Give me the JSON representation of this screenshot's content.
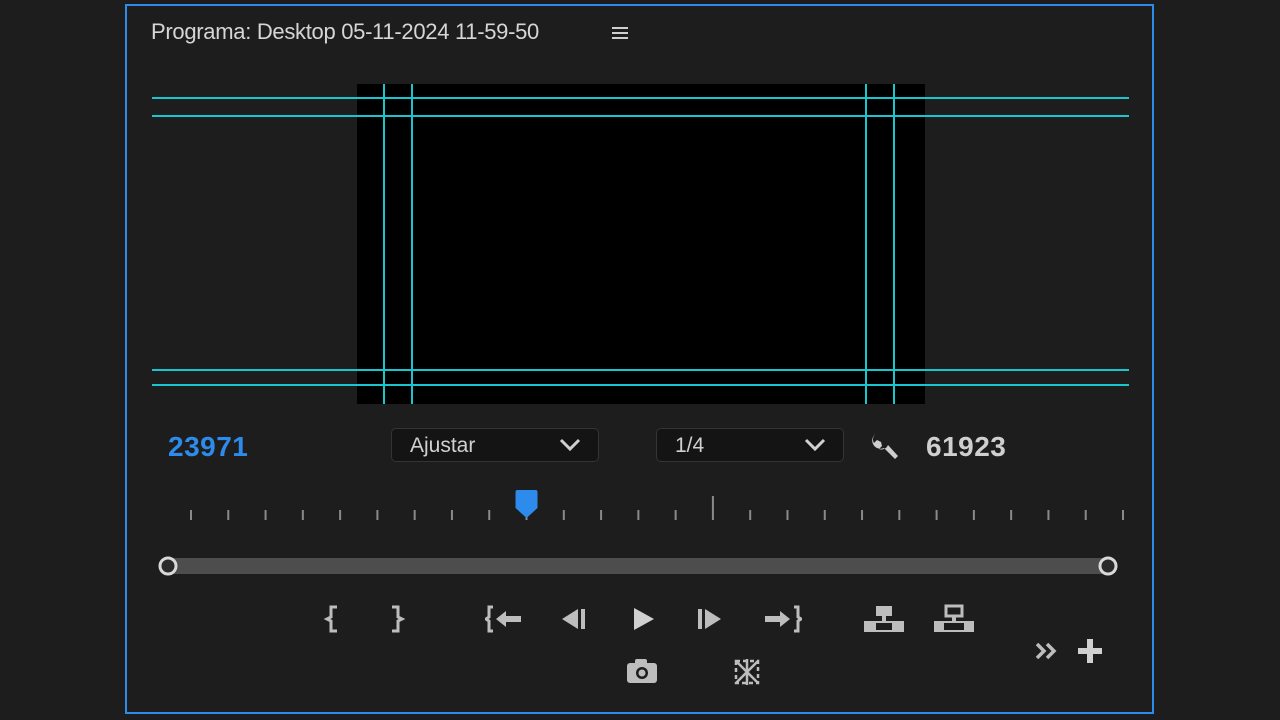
{
  "panel": {
    "title": "Programa: Desktop 05-11-2024 11-59-50",
    "menu_icon": "hamburger-menu-icon",
    "accent_color": "#2d8ceb",
    "guide_color": "#19c6d0"
  },
  "timecode": {
    "current": "23971",
    "duration": "61923"
  },
  "zoom_dropdown": {
    "selected": "Ajustar"
  },
  "resolution_dropdown": {
    "selected": "1/4"
  },
  "settings": {
    "icon": "wrench-icon"
  },
  "playhead": {
    "position_fraction": 0.36
  },
  "controls": {
    "row1": [
      {
        "name": "mark-in-button",
        "icon": "mark-in-icon"
      },
      {
        "name": "mark-out-button",
        "icon": "mark-out-icon"
      },
      {
        "name": "go-to-in-button",
        "icon": "go-to-in-icon"
      },
      {
        "name": "step-back-button",
        "icon": "step-back-icon"
      },
      {
        "name": "play-button",
        "icon": "play-icon"
      },
      {
        "name": "step-forward-button",
        "icon": "step-forward-icon"
      },
      {
        "name": "go-to-out-button",
        "icon": "go-to-out-icon"
      },
      {
        "name": "lift-button",
        "icon": "lift-icon"
      },
      {
        "name": "extract-button",
        "icon": "extract-icon"
      }
    ],
    "row2": [
      {
        "name": "export-frame-button",
        "icon": "camera-icon"
      },
      {
        "name": "comparison-view-button",
        "icon": "comparison-view-icon"
      }
    ],
    "overflow": {
      "name": "more-controls-button",
      "icon": "double-chevron-right-icon"
    },
    "add": {
      "name": "button-editor-button",
      "icon": "plus-icon"
    }
  }
}
